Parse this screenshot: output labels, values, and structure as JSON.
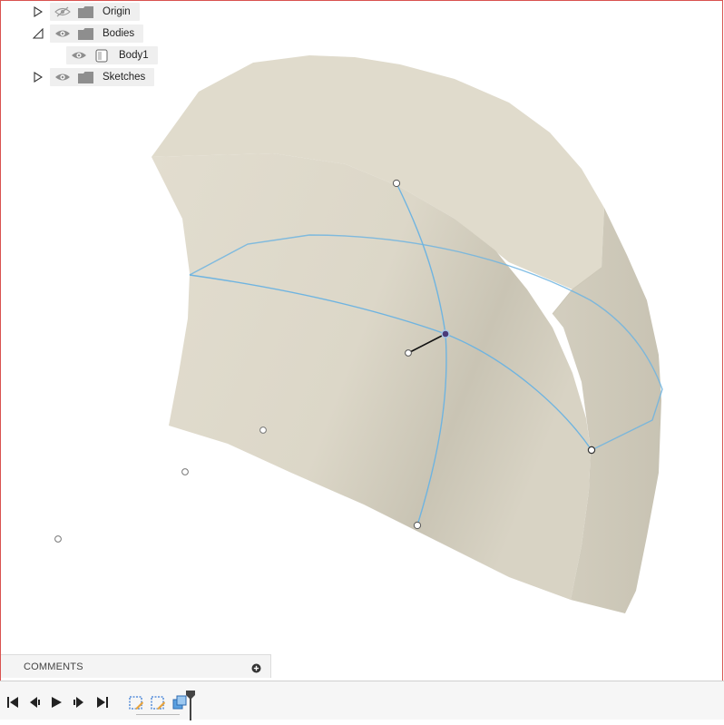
{
  "browser": {
    "items": [
      {
        "label": "Origin",
        "visible": false,
        "expanded": false
      },
      {
        "label": "Bodies",
        "visible": true,
        "expanded": true
      },
      {
        "label": "Body1",
        "visible": true
      },
      {
        "label": "Sketches",
        "visible": true,
        "expanded": false
      }
    ]
  },
  "comments": {
    "label": "COMMENTS"
  },
  "colors": {
    "surface": "#ded9cb",
    "sketch_line": "#6fb4e0",
    "viewport_border": "#d9534f"
  }
}
